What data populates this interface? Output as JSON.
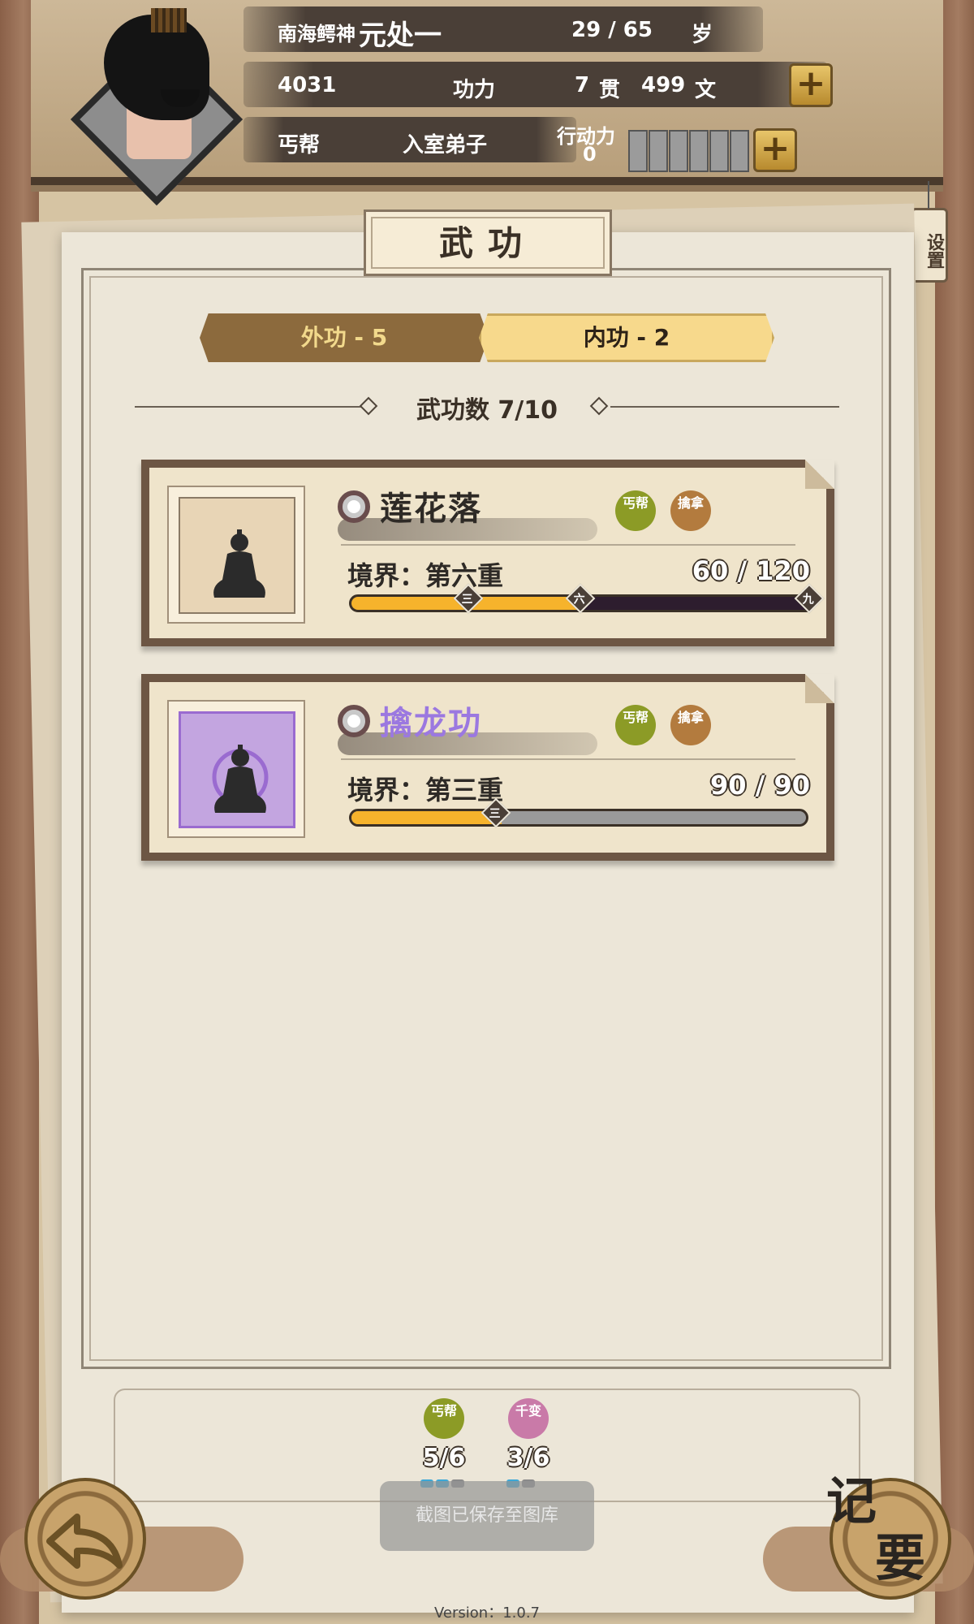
{
  "header": {
    "title_name": "南海鳄神",
    "character_name": "元处一",
    "age": "29 / 65",
    "age_unit": "岁",
    "power_value": "4031",
    "power_label": "功力",
    "money_guan": "7",
    "money_guan_unit": "贯",
    "money_wen": "499",
    "money_wen_unit": "文",
    "sect": "丐帮",
    "rank": "入室弟子",
    "action_label": "行动力",
    "action_value": "0",
    "plus_symbol": "+"
  },
  "settings": {
    "label": "设置"
  },
  "panel": {
    "title": "武功",
    "tabs": [
      {
        "label": "外功 - 5",
        "active": false
      },
      {
        "label": "内功 - 2",
        "active": true
      }
    ],
    "count_label": "武功数 7/10"
  },
  "skills": [
    {
      "name": "莲花落",
      "name_color": "#2e2a26",
      "badge_sect": "丐帮",
      "badge_type": "擒拿",
      "realm": "境界：第六重",
      "progress": "60 / 120",
      "fill_fraction": 0.5,
      "marks": [
        "三",
        "六",
        "九"
      ]
    },
    {
      "name": "擒龙功",
      "name_color": "#9b78e0",
      "badge_sect": "丐帮",
      "badge_type": "擒拿",
      "realm": "境界：第三重",
      "progress": "90 / 90",
      "fill_fraction": 0.33,
      "marks": [
        "三"
      ]
    }
  ],
  "sect_progress": [
    {
      "badge": "丐帮",
      "count": "5/6",
      "color": "#8c9b26",
      "pips_on": 2,
      "pips_total": 3
    },
    {
      "badge": "千变",
      "count": "3/6",
      "color": "#c97aa8",
      "pips_on": 1,
      "pips_total": 2
    }
  ],
  "toast": "截图已保存至图库",
  "back_icon": "back-arrow-icon",
  "notes_button": {
    "line1": "记",
    "line2": "要"
  },
  "version": "Version：1.0.7"
}
